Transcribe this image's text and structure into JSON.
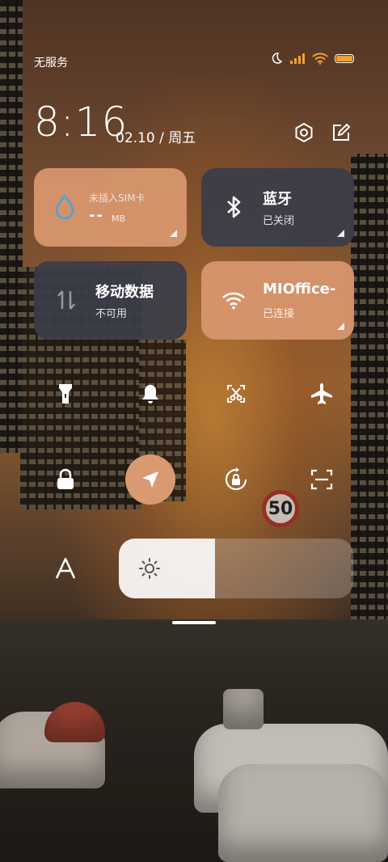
{
  "status_bar": {
    "carrier": "无服务"
  },
  "clock": {
    "time": "8:16",
    "date": "02.10 / 周五"
  },
  "tiles": {
    "sim": {
      "title": "未插入SIM卡",
      "value": "--",
      "unit": "MB"
    },
    "bluetooth": {
      "title": "蓝牙",
      "status": "已关闭"
    },
    "mobile_data": {
      "title": "移动数据",
      "status": "不可用"
    },
    "wifi": {
      "title": "MIOffice-",
      "status": "已连接"
    }
  },
  "brightness": {
    "level_percent": 41
  },
  "colors": {
    "accent_orange": "#d99a72",
    "tile_dark": "#3a3c48",
    "battery_fill": "#f0a030"
  },
  "icons": [
    "moon-icon",
    "signal-icon",
    "wifi-icon",
    "battery-icon",
    "settings-icon",
    "edit-icon",
    "water-drop-icon",
    "bluetooth-icon",
    "data-arrows-icon",
    "wifi-icon",
    "flashlight-icon",
    "bell-icon",
    "screenshot-icon",
    "airplane-icon",
    "lock-icon",
    "location-icon",
    "rotation-lock-icon",
    "scan-icon",
    "font-size-icon",
    "sun-icon"
  ],
  "background": {
    "speed_sign": "50"
  }
}
